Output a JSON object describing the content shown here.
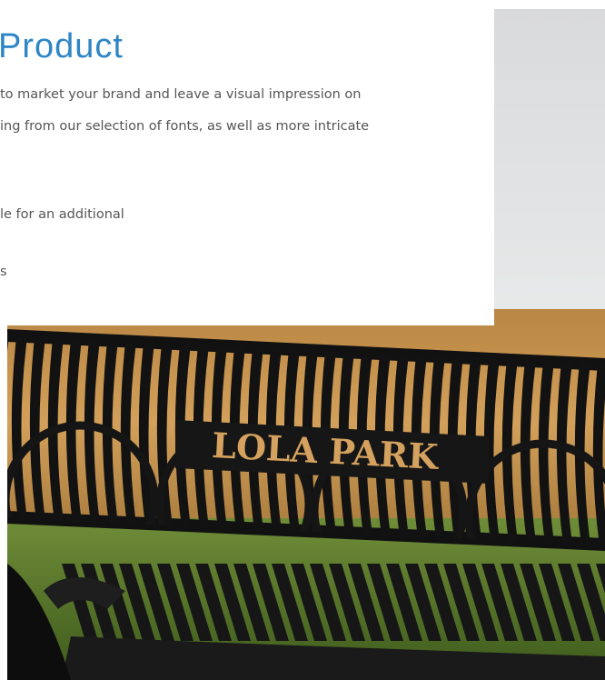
{
  "content": {
    "heading": "Product",
    "paragraph_line_1": "to market your brand and leave a visual impression on",
    "paragraph_line_2": "ing from our selection of fonts, as well as more intricate",
    "paragraph_line_3": "le for an additional",
    "paragraph_line_4": "s"
  },
  "photo": {
    "bench_sign_text": "LOLA PARK"
  },
  "colors": {
    "heading": "#2f86c6",
    "body_text": "#555555",
    "bench_metal": "#141414",
    "field_gold": "#c28a45",
    "grass": "#5c7a2c",
    "sky": "#e6e7e8"
  }
}
